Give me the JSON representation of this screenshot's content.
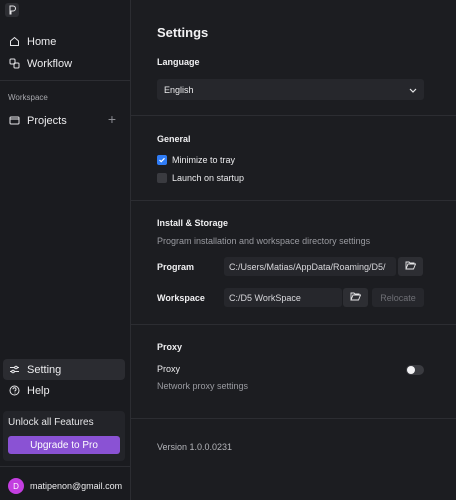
{
  "sidebar": {
    "nav": [
      {
        "label": "Home",
        "icon": "home-icon"
      },
      {
        "label": "Workflow",
        "icon": "workflow-icon"
      }
    ],
    "workspace_section": "Workspace",
    "projects": {
      "label": "Projects",
      "icon": "folder-icon"
    },
    "bottom_nav": [
      {
        "label": "Setting",
        "icon": "sliders-icon",
        "active": true
      },
      {
        "label": "Help",
        "icon": "help-icon"
      }
    ],
    "unlock": {
      "label": "Unlock all Features",
      "button": "Upgrade to Pro",
      "accent": "#8a52d4"
    },
    "user": {
      "initial": "D",
      "email": "matipenon@gmail.com",
      "avatar_color": "#c33ee0"
    }
  },
  "settings": {
    "title": "Settings",
    "language": {
      "heading": "Language",
      "selected": "English"
    },
    "general": {
      "heading": "General",
      "options": [
        {
          "label": "Minimize to tray",
          "checked": true
        },
        {
          "label": "Launch on startup",
          "checked": false
        }
      ]
    },
    "install": {
      "heading": "Install & Storage",
      "description": "Program installation and workspace directory settings",
      "program": {
        "label": "Program",
        "path": "C:/Users/Matias/AppData/Roaming/D5/"
      },
      "workspace": {
        "label": "Workspace",
        "path": "C:/D5 WorkSpace",
        "relocate": "Relocate"
      }
    },
    "proxy": {
      "heading": "Proxy",
      "label": "Proxy",
      "description": "Network proxy settings",
      "enabled": false
    },
    "version": "Version 1.0.0.0231"
  }
}
